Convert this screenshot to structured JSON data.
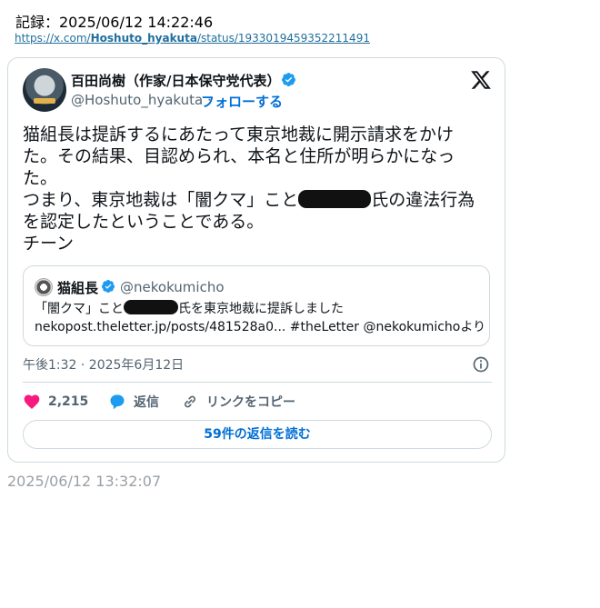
{
  "record": {
    "label": "記録：2025/06/12 14:22:46"
  },
  "source_url": {
    "prefix": "https://x.com/",
    "user": "Hoshuto_hyakuta",
    "suffix": "/status/1933019459352211491"
  },
  "tweet": {
    "author_name": "百田尚樹（作家/日本保守党代表）",
    "author_handle": "@Hoshuto_hyakuta ·",
    "follow_label": "フォローする",
    "text_line1": "猫組長は提訴するにあたって東京地裁に開示請求をかけた。その結果、目認められ、本名と住所が明らかになった。",
    "text_line2_before": "つまり、東京地裁は「闇クマ」こと",
    "text_line2_after": "氏の違法行為を認定したということである。",
    "text_line3": "チーン",
    "timestamp": "午後1:32 · 2025年6月12日",
    "likes": "2,215",
    "reply_label": "返信",
    "copy_link_label": "リンクをコピー",
    "read_replies_label": "59件の返信を読む"
  },
  "quote": {
    "author_name": "猫組長",
    "author_handle": "@nekokumicho",
    "text_before": "「闇クマ」こと",
    "text_after": "氏を東京地裁に提訴しました",
    "text_line2": "nekopost.theletter.jp/posts/481528a0... #theLetter @nekokumichoより"
  },
  "footer": {
    "timestamp": "2025/06/12 13:32:07"
  },
  "colors": {
    "accent": "#006fd6",
    "heart": "#f91880",
    "reply": "#1d9bf0",
    "verified": "#1d9bf0"
  }
}
